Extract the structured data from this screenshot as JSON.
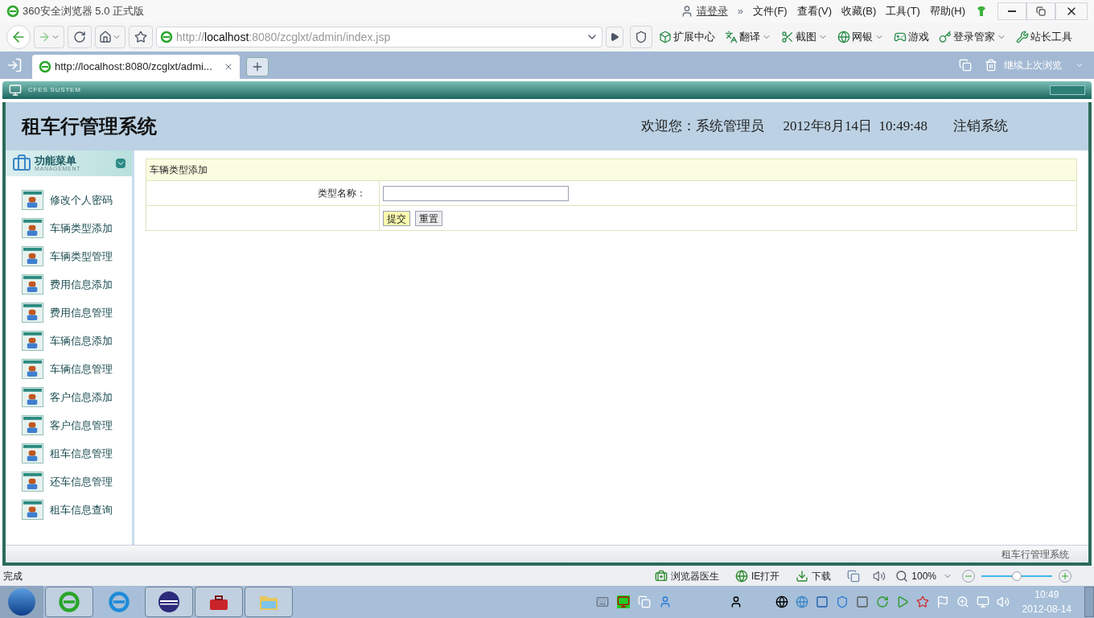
{
  "browser": {
    "title": "360安全浏览器 5.0 正式版",
    "login": "请登录",
    "overflow": "»",
    "menus": [
      "文件(F)",
      "查看(V)",
      "收藏(B)",
      "工具(T)",
      "帮助(H)"
    ],
    "url": "http://**localhost**:8080/zcglxt/admin/index.jsp",
    "toolbar_items": [
      {
        "label": "扩展中心",
        "has_menu": false
      },
      {
        "label": "翻译",
        "has_menu": true
      },
      {
        "label": "截图",
        "has_menu": true
      },
      {
        "label": "网银",
        "has_menu": true
      },
      {
        "label": "游戏",
        "has_menu": false
      },
      {
        "label": "登录管家",
        "has_menu": true
      },
      {
        "label": "站长工具",
        "has_menu": false
      }
    ],
    "tabs": [
      {
        "label": "http://localhost:8080/zcglxt/admi...",
        "selected": true
      }
    ],
    "restore": "继续上次浏览"
  },
  "app": {
    "banner": "CFES SUSTEM",
    "title": "租车行管理系统",
    "welcome": "欢迎您：系统管理员",
    "datetime": "2012年8月14日  10:49:48",
    "logout": "注销系统",
    "menu": {
      "title": "功能菜单",
      "subtitle": "MANAGEMENT",
      "items": [
        "修改个人密码",
        "车辆类型添加",
        "车辆类型管理",
        "费用信息添加",
        "费用信息管理",
        "车辆信息添加",
        "车辆信息管理",
        "客户信息添加",
        "客户信息管理",
        "租车信息管理",
        "还车信息管理",
        "租车信息查询"
      ]
    },
    "form": {
      "title": "车辆类型添加",
      "field_label": "类型名称：",
      "buttons": [
        {
          "label": "提交",
          "highlighted": true
        },
        {
          "label": "重置",
          "highlighted": false
        }
      ]
    },
    "footer": "租车行管理系统"
  },
  "status_bar": {
    "text": "完成",
    "items": [
      "浏览器医生",
      "IE打开",
      "下载"
    ],
    "zoom": "100%",
    "zoom_slider": {
      "level": 0.5
    }
  },
  "taskbar": {
    "time": "10:49",
    "date": "2012-08-14"
  }
}
